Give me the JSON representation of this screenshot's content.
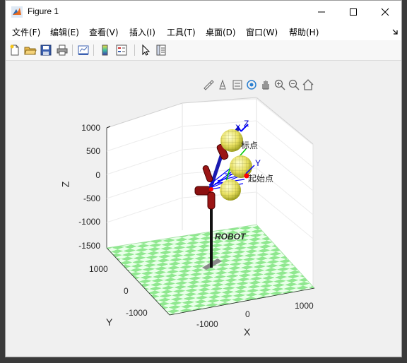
{
  "window": {
    "title": "Figure 1"
  },
  "menu": [
    "文件(F)",
    "编辑(E)",
    "查看(V)",
    "插入(I)",
    "工具(T)",
    "桌面(D)",
    "窗口(W)",
    "帮助(H)"
  ],
  "toolbar_icons": [
    "new-figure-icon",
    "open-file-icon",
    "save-icon",
    "print-icon",
    "link-plot-icon",
    "colorbar-icon",
    "legend-icon",
    "pointer-icon",
    "property-inspector-icon"
  ],
  "axes_toolbar_icons": [
    "brush-icon",
    "data-tips-icon",
    "export-icon",
    "rotate-3d-icon",
    "pan-icon",
    "zoom-in-icon",
    "zoom-out-icon",
    "home-icon"
  ],
  "plot": {
    "z_ticks": [
      "1000",
      "500",
      "0",
      "-500",
      "-1000",
      "-1500"
    ],
    "y_ticks": [
      "1000",
      "0",
      "-1000"
    ],
    "x_ticks": [
      "-1000",
      "0",
      "1000"
    ],
    "xlabel": "X",
    "ylabel": "Y",
    "zlabel": "Z",
    "robot_label": "ROBOT",
    "target_label": "标点",
    "start_label": "起始点",
    "frame_axes": {
      "x": "X",
      "y": "Y",
      "z": "Z"
    }
  }
}
